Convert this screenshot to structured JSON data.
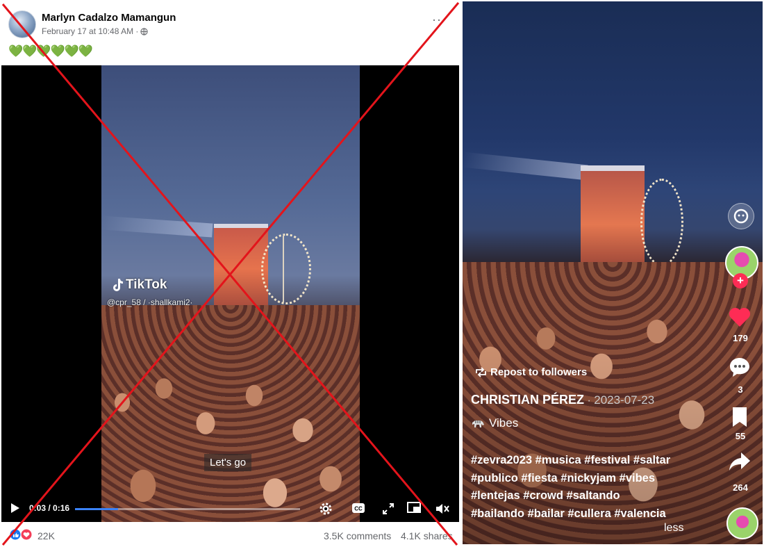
{
  "facebook_post": {
    "author": "Marlyn Cadalzo Mamangun",
    "timestamp": "February 17 at 10:48 AM ·",
    "caption": "💚💚💚💚💚💚",
    "more_icon": "ellipsis-icon",
    "video": {
      "tiktok_logo_text": "TikTok",
      "tiktok_handle": "@cpr_58 / ·shallkami2·",
      "subtitle": "Let's go",
      "time": "0:03 / 0:16",
      "progress": 0.19
    },
    "reactions_count": "22K",
    "comments": "3.5K comments",
    "shares": "4.1K shares",
    "overlay_color": "#e3141b"
  },
  "tiktok_view": {
    "repost_label": "Repost to followers",
    "author": "CHRISTIAN PÉREZ",
    "separator": " · ",
    "date": "2023-07-23",
    "sound": "Vibes",
    "hashtags": [
      "#zevra2023 #musica #festival #saltar",
      "#publico #fiesta #nickyjam #vibes",
      "#lentejas #crowd #saltando",
      "#bailando #bailar #cullera #valencia"
    ],
    "less_label": "less",
    "actions": {
      "likes": "179",
      "comments": "3",
      "bookmarks": "55",
      "shares": "264"
    },
    "like_color": "#fe2c55"
  }
}
